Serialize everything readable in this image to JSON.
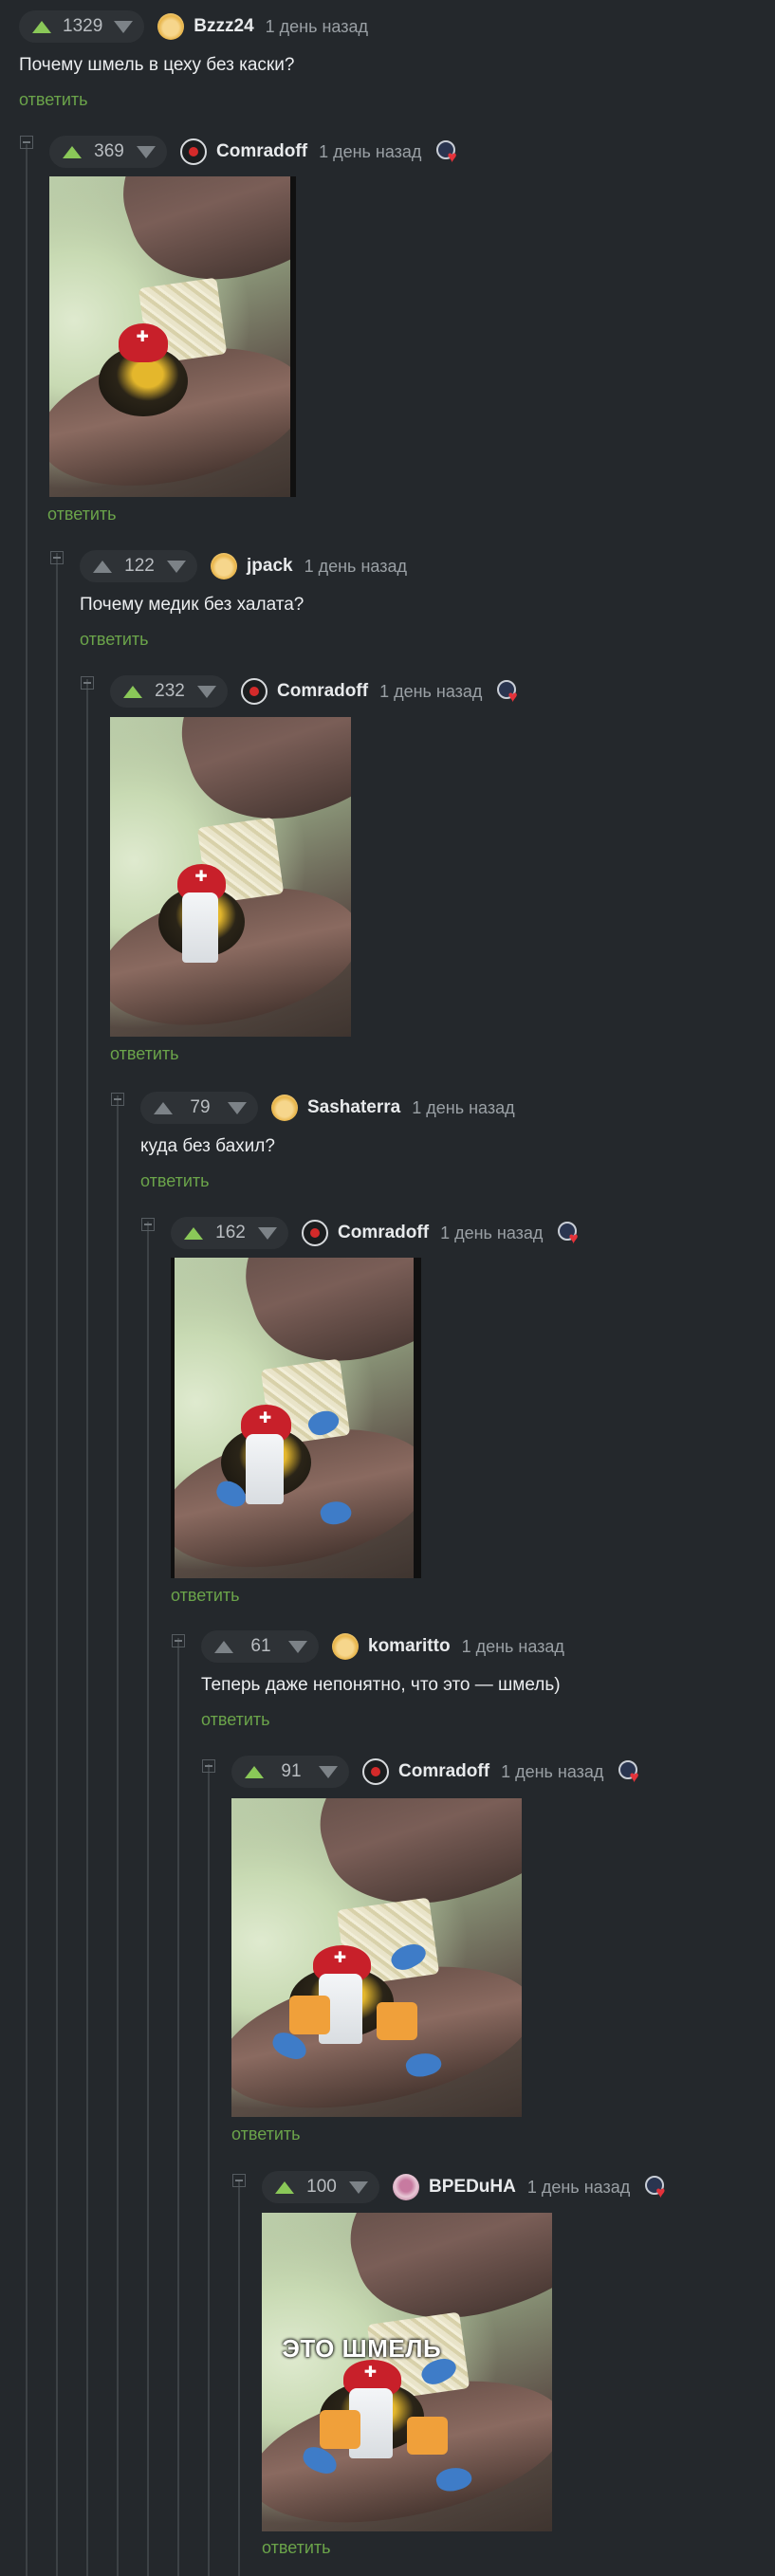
{
  "comments": [
    {
      "rating": "1329",
      "author": "Bzzz24",
      "time": "1 день назад",
      "text": "Почему шмель в цеху без каски?",
      "reply": "ответить"
    },
    {
      "rating": "369",
      "author": "Comradoff",
      "time": "1 день назад",
      "reply": "ответить"
    },
    {
      "rating": "122",
      "author": "jpack",
      "time": "1 день назад",
      "text": "Почему медик без халата?",
      "reply": "ответить"
    },
    {
      "rating": "232",
      "author": "Comradoff",
      "time": "1 день назад",
      "reply": "ответить"
    },
    {
      "rating": "79",
      "author": "Sashaterra",
      "time": "1 день назад",
      "text": "куда без бахил?",
      "reply": "ответить"
    },
    {
      "rating": "162",
      "author": "Comradoff",
      "time": "1 день назад",
      "reply": "ответить"
    },
    {
      "rating": "61",
      "author": "komaritto",
      "time": "1 день назад",
      "text": "Теперь даже непонятно, что это — шмель)",
      "reply": "ответить"
    },
    {
      "rating": "91",
      "author": "Comradoff",
      "time": "1 день назад",
      "reply": "ответить"
    },
    {
      "rating": "100",
      "author": "BPEDuHA",
      "time": "1 день назад",
      "reply": "ответить",
      "image_caption": "ЭТО ШМЕЛЬ"
    }
  ],
  "colors": {
    "background": "#24282c",
    "upvote": "#8ac858",
    "reply_link": "#6ba44a"
  },
  "icons": {
    "upvote": "arrow-up-icon",
    "downvote": "arrow-down-icon",
    "collapse": "minus-square-icon",
    "badge": "heart-badge-icon"
  }
}
